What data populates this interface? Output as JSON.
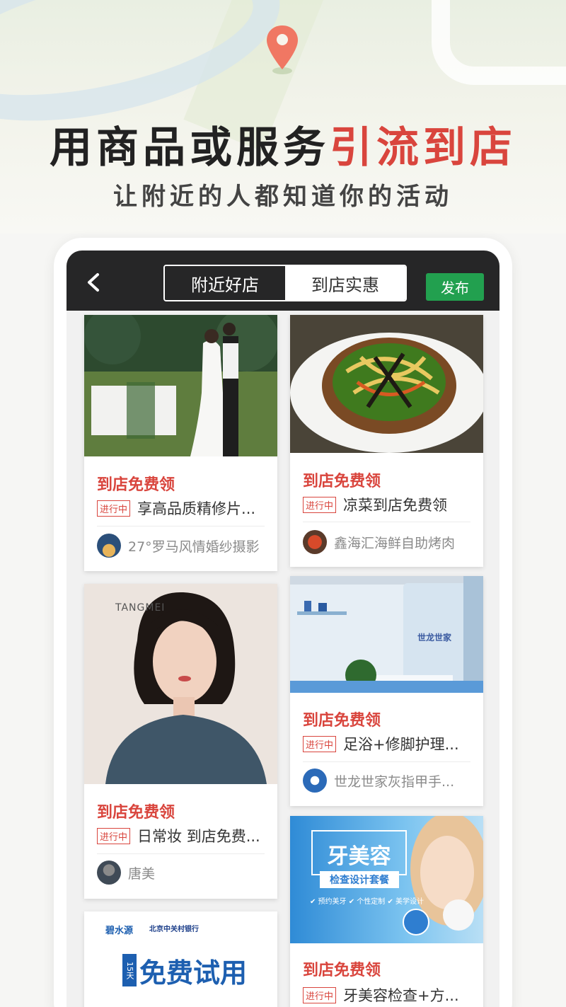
{
  "hero": {
    "title_main": "用商品或服务",
    "title_accent": "引流到店",
    "subtitle": "让附近的人都知道你的活动"
  },
  "colors": {
    "accent": "#d9453d",
    "publish_green": "#22a04f",
    "topbar": "#262627"
  },
  "topbar": {
    "back_icon": "chevron-left-icon",
    "tabs": [
      {
        "label": "附近好店",
        "active": true
      },
      {
        "label": "到店实惠",
        "active": false
      }
    ],
    "publish_label": "发布"
  },
  "cards": [
    {
      "promo": "到店免费领",
      "status": "进行中",
      "desc": "享高品质精修片...",
      "shop": "27°罗马风情婚纱摄影",
      "image": "wedding-photo"
    },
    {
      "promo": "到店免费领",
      "status": "进行中",
      "desc": "凉菜到店免费领",
      "shop": "鑫海汇海鲜自助烤肉",
      "image": "cold-dish-photo"
    },
    {
      "promo": "到店免费领",
      "status": "进行中",
      "desc": "日常妆 到店免费...",
      "shop": "唐美",
      "image": "portrait-photo",
      "image_brand": "TANGMEI"
    },
    {
      "promo": "到店免费领",
      "status": "进行中",
      "desc": "足浴+修脚护理...",
      "shop": "世龙世家灰指甲手...",
      "image": "salon-interior-photo",
      "image_brand": "世龙世家"
    },
    {
      "promo": "到店免费领",
      "status": "进行中",
      "desc": "牙美容检查+方...",
      "image": "dental-ad",
      "ad": {
        "title": "牙美容",
        "subtitle": "检查设计套餐",
        "bullets": "✔ 预约美牙  ✔ 个性定制  ✔ 美学设计"
      }
    },
    {
      "image": "trial-ad",
      "ad": {
        "brand_left": "碧水源",
        "brand_right": "北京中关村银行",
        "days": "15天",
        "title": "免费试用"
      }
    }
  ]
}
